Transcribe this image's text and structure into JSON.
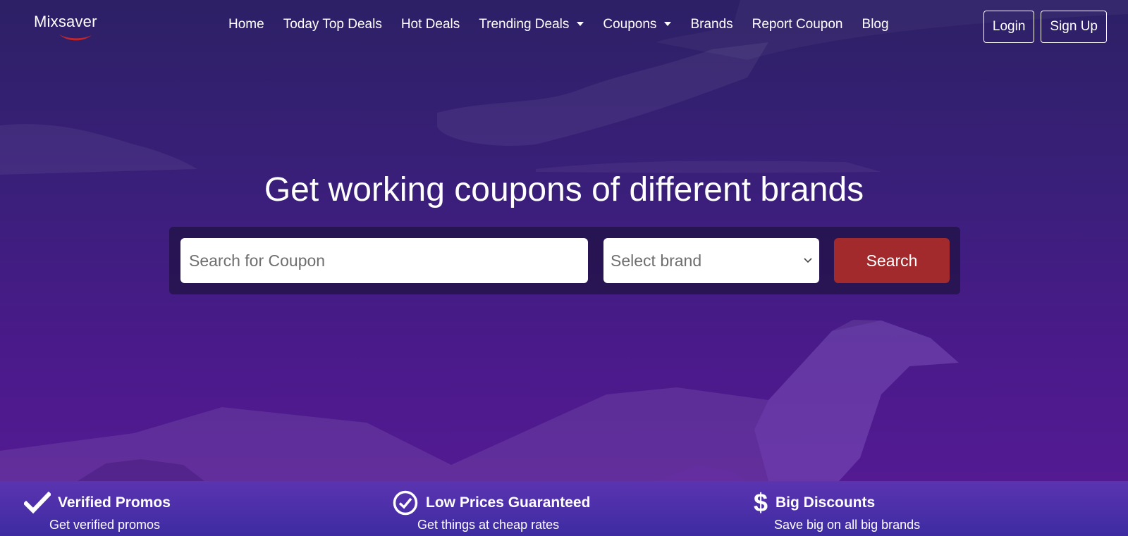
{
  "brand": {
    "logo_text": "Mixsaver",
    "swoosh_color": "#c0272d"
  },
  "nav": {
    "items": [
      {
        "label": "Home",
        "dropdown": false
      },
      {
        "label": "Today Top Deals",
        "dropdown": false
      },
      {
        "label": "Hot Deals",
        "dropdown": false
      },
      {
        "label": "Trending Deals",
        "dropdown": true
      },
      {
        "label": "Coupons",
        "dropdown": true
      },
      {
        "label": "Brands",
        "dropdown": false
      },
      {
        "label": "Report Coupon",
        "dropdown": false
      },
      {
        "label": "Blog",
        "dropdown": false
      }
    ],
    "login_label": "Login",
    "signup_label": "Sign Up"
  },
  "hero": {
    "title": "Get working coupons of different brands",
    "search_placeholder": "Search for Coupon",
    "brand_select_value": "Select brand",
    "search_button_label": "Search"
  },
  "features": [
    {
      "icon": "checkmark-icon",
      "title": "Verified Promos",
      "subtitle": "Get verified promos"
    },
    {
      "icon": "check-circle-icon",
      "title": "Low Prices Guaranteed",
      "subtitle": "Get things at cheap rates"
    },
    {
      "icon": "dollar-icon",
      "title": "Big Discounts",
      "subtitle": "Save big on all big brands"
    }
  ],
  "colors": {
    "accent": "#a32a2c",
    "background_top": "#2d2066",
    "background_bottom": "#571a96",
    "feature_bar": "#4a30a8"
  }
}
